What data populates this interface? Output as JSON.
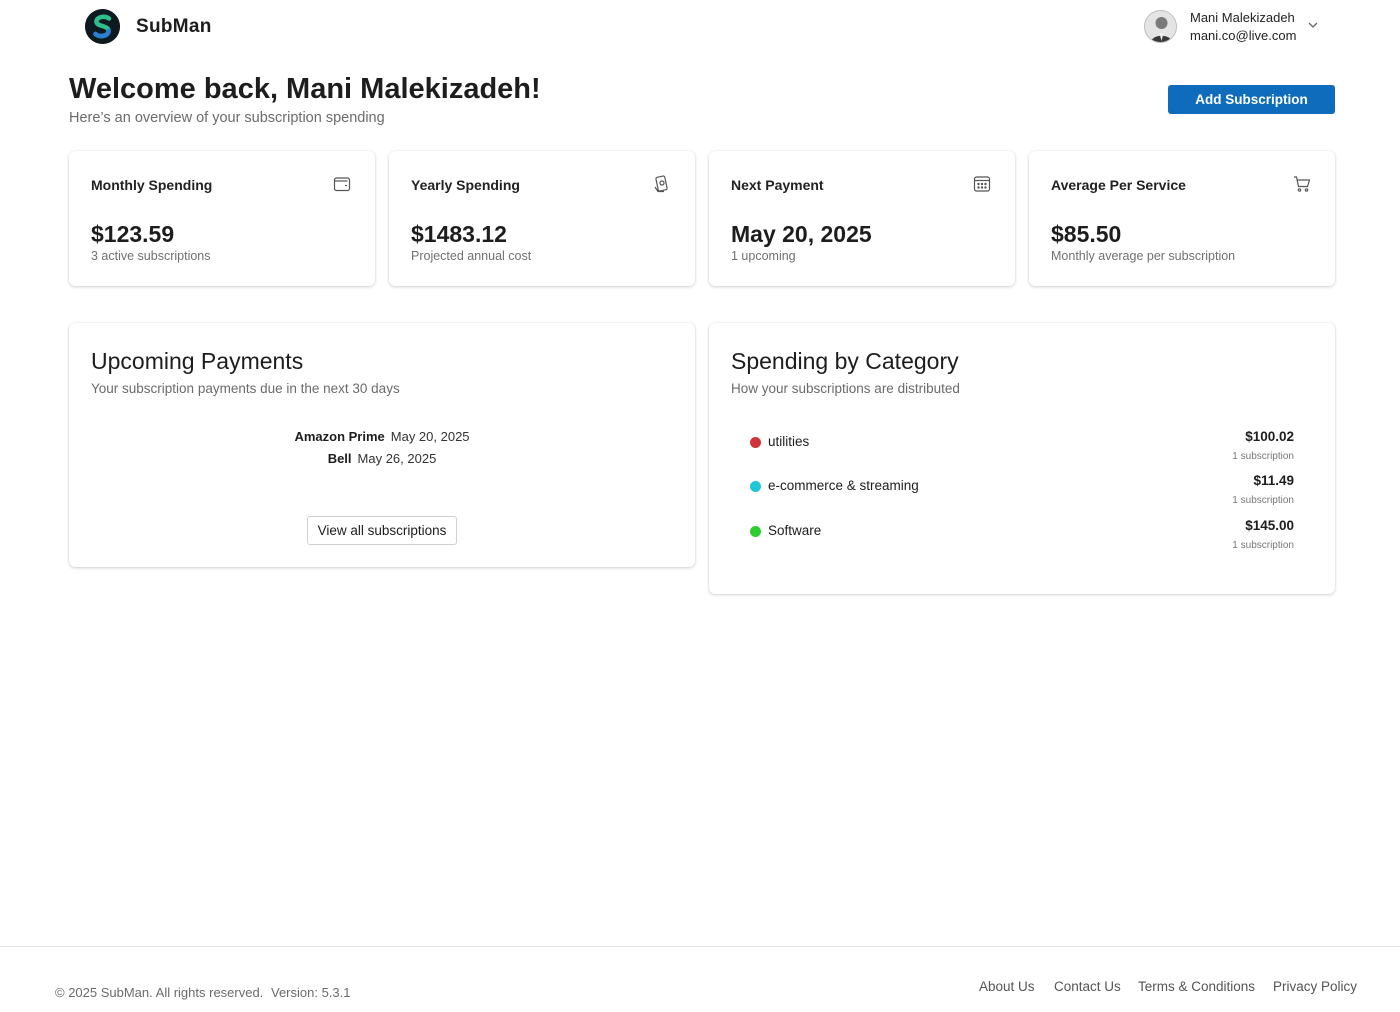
{
  "app": {
    "brand": "SubMan"
  },
  "user": {
    "name": "Mani Malekizadeh",
    "email": "mani.co@live.com"
  },
  "welcome": {
    "title": "Welcome back, Mani Malekizadeh!",
    "subtitle": "Here’s an overview of your subscription spending",
    "add_button": "Add Subscription"
  },
  "stats": [
    {
      "title": "Monthly Spending",
      "value": "$123.59",
      "sub": "3 active subscriptions",
      "icon": "wallet-icon"
    },
    {
      "title": "Yearly Spending",
      "value": "$1483.12",
      "sub": "Projected annual cost",
      "icon": "money-hand-icon"
    },
    {
      "title": "Next Payment",
      "value": "May 20, 2025",
      "sub": "1 upcoming",
      "icon": "calendar-icon"
    },
    {
      "title": "Average Per Service",
      "value": "$85.50",
      "sub": "Monthly average per subscription",
      "icon": "cart-icon"
    }
  ],
  "upcoming": {
    "title": "Upcoming Payments",
    "subtitle": "Your subscription payments due in the next 30 days",
    "items": [
      {
        "name": "Amazon Prime",
        "date": "May 20, 2025"
      },
      {
        "name": "Bell",
        "date": "May 26, 2025"
      }
    ],
    "view_all": "View all subscriptions"
  },
  "categories": {
    "title": "Spending by Category",
    "subtitle": "How your subscriptions are distributed",
    "items": [
      {
        "label": "utilities",
        "amount": "$100.02",
        "count": "1 subscription",
        "color": "#d13438"
      },
      {
        "label": "e-commerce & streaming",
        "amount": "$11.49",
        "count": "1 subscription",
        "color": "#1fc6d6"
      },
      {
        "label": "Software",
        "amount": "$145.00",
        "count": "1 subscription",
        "color": "#2ecc2e"
      }
    ]
  },
  "footer": {
    "copyright": "© 2025 SubMan. All rights reserved.",
    "version": "Version: 5.3.1",
    "links": [
      "About Us",
      "Contact Us",
      "Terms & Conditions",
      "Privacy Policy"
    ]
  }
}
